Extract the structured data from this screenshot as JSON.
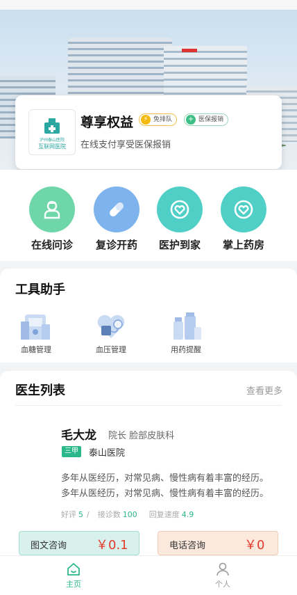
{
  "hero": {
    "hospital_logo_line1": "泸州泰山医院",
    "hospital_logo_line2": "互联网医院"
  },
  "privilege": {
    "title": "尊享权益",
    "tags": [
      {
        "label": "免排队",
        "icon": "lightning-icon",
        "color": "#f6b90f"
      },
      {
        "label": "医保报销",
        "icon": "plus-icon",
        "color": "#3fbf85"
      }
    ],
    "subtitle": "在线支付享受医保报销"
  },
  "services": [
    {
      "label": "在线问诊",
      "icon": "doctor-icon",
      "color": "#6ed6a8"
    },
    {
      "label": "复诊开药",
      "icon": "pill-icon",
      "color": "#7fb3ee"
    },
    {
      "label": "医护到家",
      "icon": "heart-home-icon",
      "color": "#4fcfc6"
    },
    {
      "label": "掌上药房",
      "icon": "heart-home-icon",
      "color": "#4fcfc6"
    }
  ],
  "tools": {
    "title": "工具助手",
    "items": [
      {
        "label": "血糖管理",
        "icon": "glucose-meter-icon"
      },
      {
        "label": "血压管理",
        "icon": "blood-pressure-icon"
      },
      {
        "label": "用药提醒",
        "icon": "medicine-bottles-icon"
      }
    ]
  },
  "doctors": {
    "title": "医生列表",
    "see_more": "查看更多",
    "list": [
      {
        "name": "毛大龙",
        "title": "院长 脸部皮肤科",
        "grade": "三甲",
        "hospital": "泰山医院",
        "bio": "多年从医经历，对常见病、慢性病有着丰富的经历。多年从医经历，对常见病、慢性病有着丰富的经历。",
        "stats": {
          "praise_label": "好评",
          "praise_value": "5",
          "visits_label": "接诊数",
          "visits_value": "100",
          "reply_label": "回复速度",
          "reply_value": "4.9",
          "separator": "/"
        },
        "consult_text": {
          "label": "图文咨询",
          "price": "￥0.1"
        },
        "consult_phone": {
          "label": "电话咨询",
          "price": "￥0"
        }
      }
    ]
  },
  "tabbar": {
    "items": [
      {
        "label": "主页",
        "icon": "home-icon",
        "active": true,
        "color": "#2ab88a"
      },
      {
        "label": "个人",
        "icon": "person-icon",
        "active": false,
        "color": "#999999"
      }
    ]
  },
  "colors": {
    "accent": "#2ab88a",
    "price": "#e23a2c"
  }
}
